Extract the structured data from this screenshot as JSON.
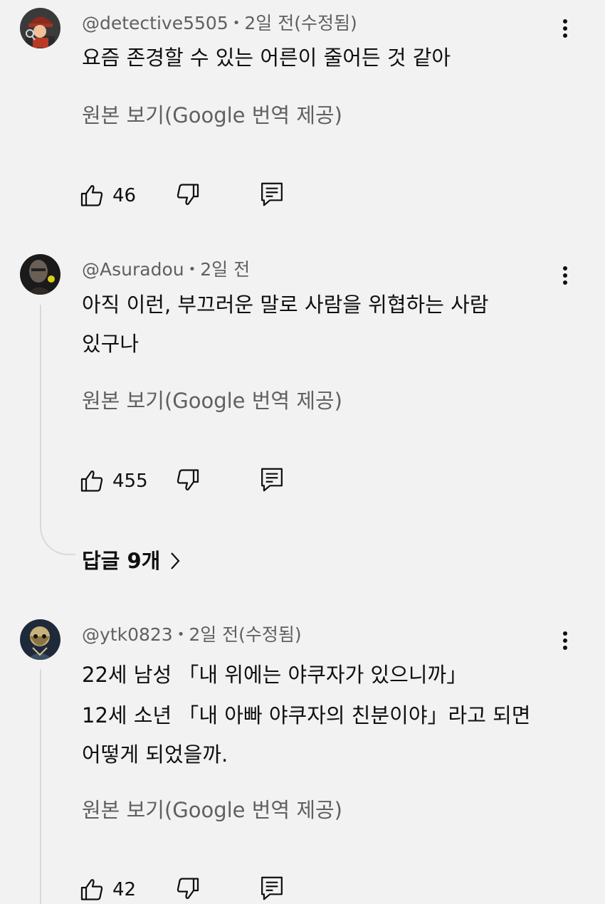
{
  "comments": [
    {
      "author": "@detective5505",
      "time": "2일 전(수정됨)",
      "lines": [
        "요즘 존경할 수 있는 어른이 줄어든 것 같아"
      ],
      "translate_label": "원본 보기(Google 번역 제공)",
      "likes": "46"
    },
    {
      "author": "@Asuradou",
      "time": "2일 전",
      "lines": [
        "아직 이런, 부끄러운 말로 사람을 위협하는 사람",
        "있구나"
      ],
      "translate_label": "원본 보기(Google 번역 제공)",
      "likes": "455",
      "replies_label": "답글 9개"
    },
    {
      "author": "@ytk0823",
      "time": "2일 전(수정됨)",
      "lines": [
        "22세 남성 「내 위에는 야쿠자가 있으니까」",
        "12세 소년 「내 아빠 야쿠자의 친분이야」라고 되면",
        "어떻게 되었을까."
      ],
      "translate_label": "원본 보기(Google 번역 제공)",
      "likes": "42"
    }
  ],
  "separator": "•",
  "icons": {
    "like": "thumb-up-icon",
    "dislike": "thumb-down-icon",
    "reply": "reply-comment-icon",
    "more": "more-vert-icon",
    "chevron": "chevron-right-icon"
  },
  "colors": {
    "background": "#f2f2f2",
    "text": "#0f0f0f",
    "secondary_text": "#606060",
    "thread_line": "#d9d9d9"
  }
}
